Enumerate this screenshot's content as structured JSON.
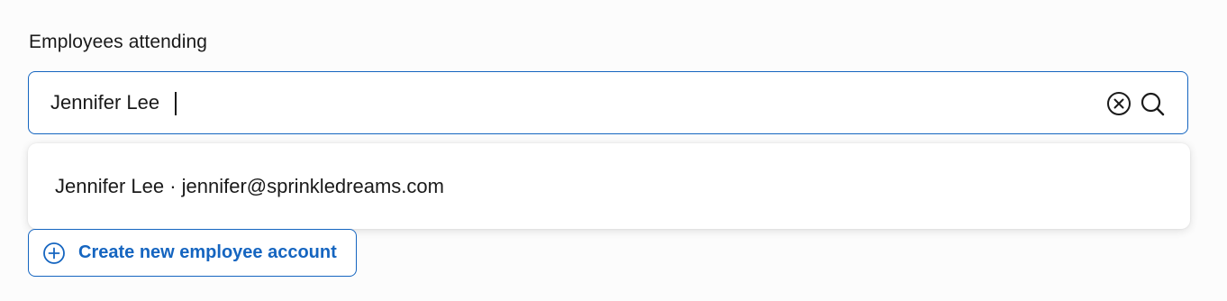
{
  "field": {
    "label": "Employees attending"
  },
  "search": {
    "value": "Jennifer Lee",
    "clear_icon": "clear-circle-x-icon",
    "search_icon": "magnifier-icon"
  },
  "results": [
    {
      "text": "Jennifer Lee · jennifer@sprinkledreams.com"
    }
  ],
  "create_account": {
    "label": "Create new employee account",
    "icon": "plus-circle-icon"
  },
  "colors": {
    "accent": "#1565c0",
    "text": "#1a1a1a",
    "background": "#fcfcfc",
    "surface": "#ffffff"
  }
}
